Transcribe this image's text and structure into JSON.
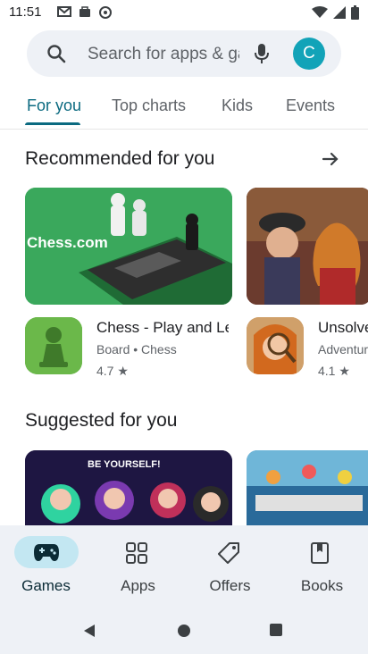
{
  "status_bar": {
    "time": "11:51"
  },
  "search": {
    "placeholder": "Search for apps & games"
  },
  "account": {
    "initial": "C"
  },
  "tabs": [
    {
      "label": "For you",
      "active": true
    },
    {
      "label": "Top charts",
      "active": false
    },
    {
      "label": "Kids",
      "active": false
    },
    {
      "label": "Events",
      "active": false
    }
  ],
  "recommended": {
    "title": "Recommended for you",
    "apps": [
      {
        "name": "Chess - Play and Learn",
        "category": "Board • Chess",
        "rating": "4.7 ★",
        "banner_text": "Chess.com"
      },
      {
        "name": "Unsolved Case",
        "category": "Adventure",
        "rating": "4.1 ★"
      }
    ]
  },
  "suggested": {
    "title": "Suggested for you",
    "items": [
      {
        "banner_text": "BE YOURSELF!"
      },
      {
        "banner_text": ""
      }
    ]
  },
  "bottom_nav": [
    {
      "label": "Games",
      "icon": "gamepad-icon",
      "active": true
    },
    {
      "label": "Apps",
      "icon": "apps-grid-icon",
      "active": false
    },
    {
      "label": "Offers",
      "icon": "tag-icon",
      "active": false
    },
    {
      "label": "Books",
      "icon": "bookmark-book-icon",
      "active": false
    }
  ],
  "colors": {
    "accent": "#0b6a80",
    "nav_background": "#eef1f6",
    "active_pill": "#c3e7f2"
  }
}
